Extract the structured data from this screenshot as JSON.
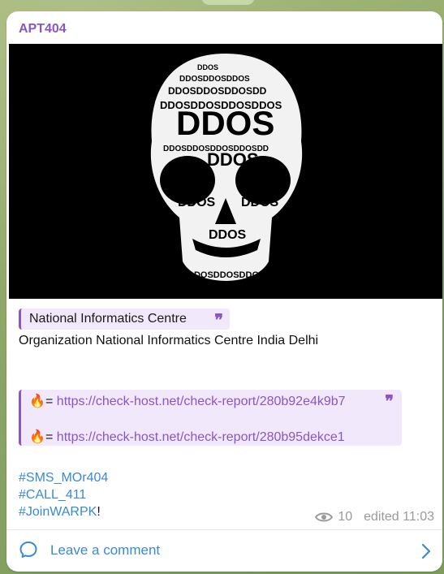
{
  "post": {
    "channel_name": "APT404",
    "image_alt": "DDOS skull image",
    "image_word": "DDOS",
    "reply": {
      "title": "National Informatics Centre",
      "quote_icon": "quote-icon"
    },
    "organization_line": "Organization National Informatics Centre India Delhi",
    "links": [
      {
        "emoji": "🔥",
        "sep": "= ",
        "url": "https://check-host.net/check-report/280b92e4k9b7"
      },
      {
        "emoji": "🔥",
        "sep": "= ",
        "url": "https://check-host.net/check-report/280b95dekce1"
      }
    ],
    "hashtags": [
      "#SMS_MOr404",
      "#CALL_411",
      "#JoinWARPK"
    ],
    "hashtag_suffix": "!",
    "views": "10",
    "edited": "edited 11:03"
  },
  "footer": {
    "comment_label": "Leave a comment"
  },
  "colors": {
    "accent": "#8a56c6",
    "link_blue": "#3a8ad0",
    "quote_bg": "#f1e8fb"
  }
}
